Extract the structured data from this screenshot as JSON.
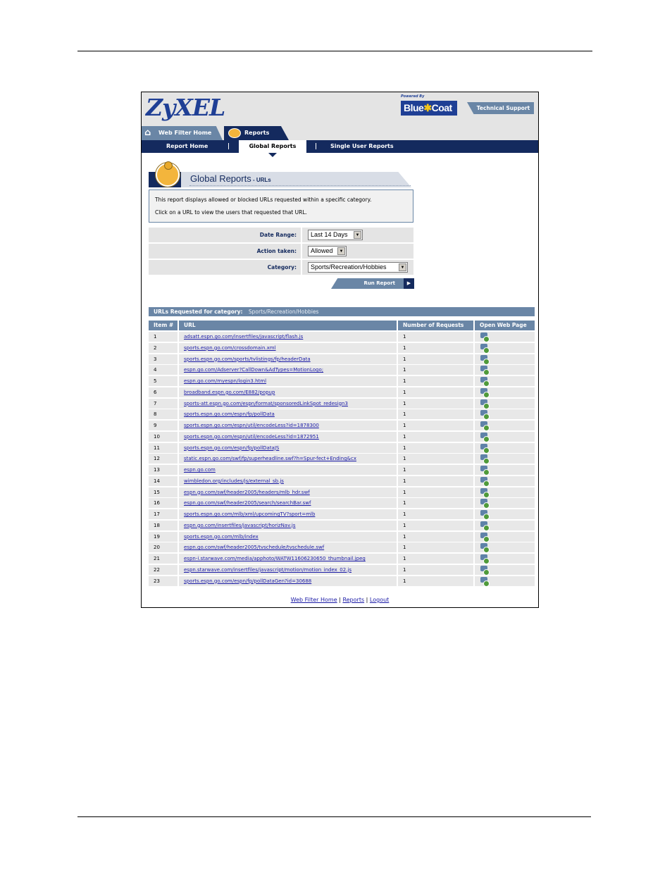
{
  "header": {
    "logo": "ZyXEL",
    "powered_by": "Powered By",
    "bluecoat_left": "Blue",
    "bluecoat_right": "Coat",
    "tech_support": "Technical Support"
  },
  "tabs": {
    "web_filter_home": "Web Filter Home",
    "reports": "Reports"
  },
  "nav": {
    "report_home": "Report Home",
    "global_reports": "Global Reports",
    "single_user_reports": "Single User Reports"
  },
  "title": {
    "main": "Global Reports",
    "sub": " - URLs"
  },
  "description": {
    "line1": "This report displays allowed or blocked URLs requested within a specific category.",
    "line2": "Click on a URL to view the users that requested that URL."
  },
  "form": {
    "date_range_label": "Date Range:",
    "date_range_value": "Last 14 Days",
    "action_label": "Action taken:",
    "action_value": "Allowed",
    "category_label": "Category:",
    "category_value": "Sports/Recreation/Hobbies"
  },
  "run_report": "Run Report",
  "section": {
    "label": "URLs Requested for category:",
    "category": "Sports/Recreation/Hobbies"
  },
  "table": {
    "headers": [
      "Item #",
      "URL",
      "Number of Requests",
      "Open Web Page"
    ],
    "rows": [
      {
        "item": "1",
        "url": "adsatt.espn.go.com/insertfiles/javascript/flash.js",
        "requests": "1"
      },
      {
        "item": "2",
        "url": "sports.espn.go.com/crossdomain.xml",
        "requests": "1"
      },
      {
        "item": "3",
        "url": "sports.espn.go.com/sports/tvlistings/fp/headerData",
        "requests": "1"
      },
      {
        "item": "4",
        "url": "espn.go.com/Adserver?CallDown&AdTypes=MotionLogo;",
        "requests": "1"
      },
      {
        "item": "5",
        "url": "espn.go.com/myespn/login3.html",
        "requests": "1"
      },
      {
        "item": "6",
        "url": "broadband.espn.go.com/E882/popup",
        "requests": "1"
      },
      {
        "item": "7",
        "url": "sports-att.espn.go.com/espn/format/sponsoredLinkSpot_redesign3",
        "requests": "1"
      },
      {
        "item": "8",
        "url": "sports.espn.go.com/espn/fp/pollData",
        "requests": "1"
      },
      {
        "item": "9",
        "url": "sports.espn.go.com/espn/util/encodeLess?id=1878300",
        "requests": "1"
      },
      {
        "item": "10",
        "url": "sports.espn.go.com/espn/util/encodeLess?id=1872951",
        "requests": "1"
      },
      {
        "item": "11",
        "url": "sports.espn.go.com/espn/fp/pollDataJS",
        "requests": "1"
      },
      {
        "item": "12",
        "url": "static.espn.go.com/swf/fp/superheadline.swf?h=Spur-fect+Ending&cx",
        "requests": "1"
      },
      {
        "item": "13",
        "url": "espn.go.com",
        "requests": "1"
      },
      {
        "item": "14",
        "url": "wimbledon.org/includes/js/external_sb.js",
        "requests": "1"
      },
      {
        "item": "15",
        "url": "espn.go.com/swf/header2005/headers/mlb_hdr.swf",
        "requests": "1"
      },
      {
        "item": "16",
        "url": "espn.go.com/swf/header2005/search/searchBar.swf",
        "requests": "1"
      },
      {
        "item": "17",
        "url": "sports.espn.go.com/mlb/xml/upcomingTV?sport=mlb",
        "requests": "1"
      },
      {
        "item": "18",
        "url": "espn.go.com/insertfiles/javascript/horizNav.js",
        "requests": "1"
      },
      {
        "item": "19",
        "url": "sports.espn.go.com/mlb/index",
        "requests": "1"
      },
      {
        "item": "20",
        "url": "espn.go.com/swf/header2005/tvschedule/tvschedule.swf",
        "requests": "1"
      },
      {
        "item": "21",
        "url": "espn-i.starwave.com/media/apphoto/WATW11606230650_thumbnail.jpeg",
        "requests": "1"
      },
      {
        "item": "22",
        "url": "espn.starwave.com/insertfiles/javascript/motion/motion_index_02.js",
        "requests": "1"
      },
      {
        "item": "23",
        "url": "sports.espn.go.com/espn/fp/pollDataGen?id=30688",
        "requests": "1"
      }
    ]
  },
  "footer": {
    "web_filter_home": "Web Filter Home",
    "sep": "|",
    "reports": "Reports",
    "logout": "Logout"
  }
}
